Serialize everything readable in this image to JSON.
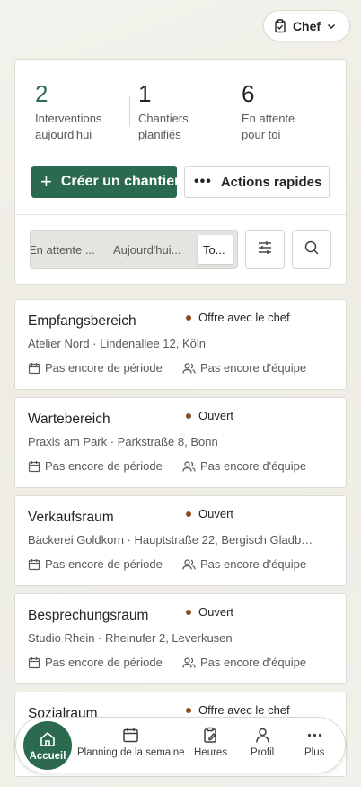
{
  "role_selector": {
    "label": "Chef",
    "icon": "clipboard-check-icon"
  },
  "stats": [
    {
      "value": "2",
      "label_line1": "Interventions",
      "label_line2": "aujourd'hui"
    },
    {
      "value": "1",
      "label_line1": "Chantiers",
      "label_line2": "planifiés"
    },
    {
      "value": "6",
      "label_line1": "En attente",
      "label_line2": "pour toi"
    }
  ],
  "actions": {
    "create_label": "Créer un chantier",
    "quick_label": "Actions rapides"
  },
  "filter_tabs": [
    {
      "label": "En attente ...",
      "selected": false
    },
    {
      "label": "Aujourd'hui...",
      "selected": false
    },
    {
      "label": "To...",
      "selected": true
    }
  ],
  "filter_icon": "sliders-icon",
  "search_icon": "search-icon",
  "jobs": [
    {
      "title": "Empfangsbereich",
      "status": "Offre avec le chef",
      "address": "Atelier Nord · Lindenallee 12, Köln",
      "period": "Pas encore de période",
      "team": "Pas encore d'équipe"
    },
    {
      "title": "Wartebereich",
      "status": "Ouvert",
      "address": "Praxis am Park · Parkstraße 8, Bonn",
      "period": "Pas encore de période",
      "team": "Pas encore d'équipe"
    },
    {
      "title": "Verkaufsraum",
      "status": "Ouvert",
      "address": "Bäckerei Goldkorn · Hauptstraße 22, Bergisch Gladb…",
      "period": "Pas encore de période",
      "team": "Pas encore d'équipe"
    },
    {
      "title": "Besprechungsraum",
      "status": "Ouvert",
      "address": "Studio Rhein · Rheinufer 2, Leverkusen",
      "period": "Pas encore de période",
      "team": "Pas encore d'équipe"
    },
    {
      "title": "Sozialraum",
      "status": "Offre avec le chef"
    }
  ],
  "colors": {
    "accent": "#2b6a4e",
    "status_dot": "#8a4a1c"
  },
  "bottom_nav": [
    {
      "label": "Accueil",
      "icon": "home-icon",
      "active": true
    },
    {
      "label": "Planning de la semaine",
      "icon": "calendar-icon",
      "active": false
    },
    {
      "label": "Heures",
      "icon": "clipboard-edit-icon",
      "active": false
    },
    {
      "label": "Profil",
      "icon": "user-icon",
      "active": false
    },
    {
      "label": "Plus",
      "icon": "more-icon",
      "active": false
    }
  ]
}
